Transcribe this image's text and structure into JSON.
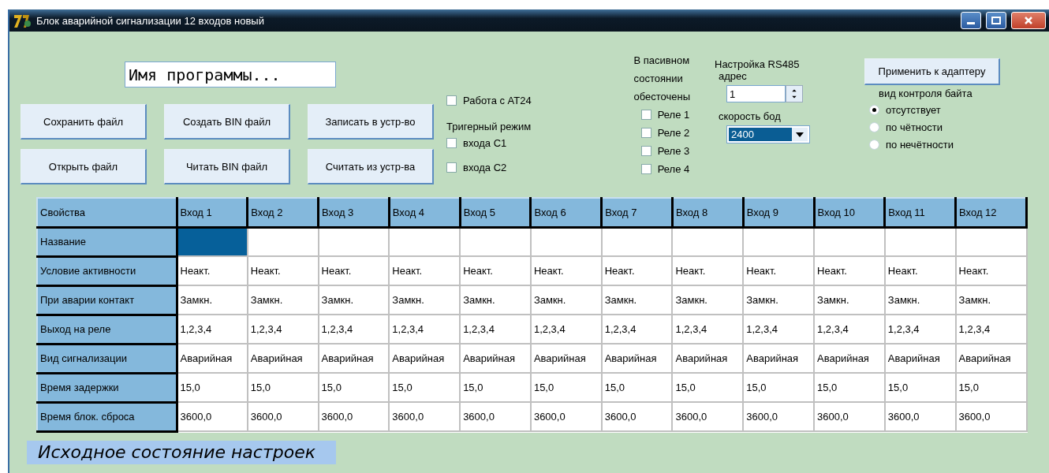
{
  "window": {
    "title": "Блок аварийной сигнализации 12 входов новый"
  },
  "program_name": {
    "value": "Имя программы..."
  },
  "file_buttons": [
    {
      "label": "Сохранить файл"
    },
    {
      "label": "Создать BIN файл"
    },
    {
      "label": "Записать в устр-во"
    },
    {
      "label": "Открыть файл"
    },
    {
      "label": "Читать BIN файл"
    },
    {
      "label": "Считать из устр-ва"
    }
  ],
  "at24": {
    "label": "Работа с AT24",
    "checked": false
  },
  "trigger_mode": {
    "title": "Тригерный режим",
    "items": [
      {
        "label": "входа C1",
        "checked": false
      },
      {
        "label": "входа C2",
        "checked": false
      }
    ]
  },
  "passive_relays": {
    "title": "В пасивном состоянии обесточены",
    "items": [
      {
        "label": "Реле 1",
        "checked": false
      },
      {
        "label": "Реле 2",
        "checked": false
      },
      {
        "label": "Реле 3",
        "checked": false
      },
      {
        "label": "Реле 4",
        "checked": false
      }
    ]
  },
  "rs485": {
    "title": "Настройка RS485",
    "address_label": "адрес",
    "address": "1",
    "baud_label": "скорость бод",
    "baud": "2400"
  },
  "apply_button": {
    "label": "Применить к адаптеру"
  },
  "byte_control": {
    "title": "вид контроля байта",
    "options": [
      {
        "label": "отсутствует",
        "selected": true
      },
      {
        "label": "по чётности",
        "selected": false
      },
      {
        "label": "по нечётности",
        "selected": false
      }
    ]
  },
  "table": {
    "columns": [
      "Свойства",
      "Вход 1",
      "Вход 2",
      "Вход 3",
      "Вход 4",
      "Вход 5",
      "Вход 6",
      "Вход 7",
      "Вход 8",
      "Вход 9",
      "Вход 10",
      "Вход 11",
      "Вход 12"
    ],
    "rows": [
      {
        "label": "Название",
        "cells": [
          {
            "selected": true
          },
          {
            "selected": false
          },
          {
            "selected": false
          },
          {
            "selected": false
          },
          {
            "selected": false
          },
          {
            "selected": false
          },
          {
            "selected": false
          },
          {
            "selected": false
          },
          {
            "selected": false
          },
          {
            "selected": false
          },
          {
            "selected": false
          },
          {
            "selected": false
          }
        ]
      },
      {
        "label": "Условие активности",
        "values": [
          "Неакт.",
          "Неакт.",
          "Неакт.",
          "Неакт.",
          "Неакт.",
          "Неакт.",
          "Неакт.",
          "Неакт.",
          "Неакт.",
          "Неакт.",
          "Неакт.",
          "Неакт."
        ]
      },
      {
        "label": "При аварии контакт",
        "values": [
          "Замкн.",
          "Замкн.",
          "Замкн.",
          "Замкн.",
          "Замкн.",
          "Замкн.",
          "Замкн.",
          "Замкн.",
          "Замкн.",
          "Замкн.",
          "Замкн.",
          "Замкн."
        ]
      },
      {
        "label": "Выход на реле",
        "values": [
          "1,2,3,4",
          "1,2,3,4",
          "1,2,3,4",
          "1,2,3,4",
          "1,2,3,4",
          "1,2,3,4",
          "1,2,3,4",
          "1,2,3,4",
          "1,2,3,4",
          "1,2,3,4",
          "1,2,3,4",
          "1,2,3,4"
        ]
      },
      {
        "label": "Вид сигнализации",
        "values": [
          "Аварийная",
          "Аварийная",
          "Аварийная",
          "Аварийная",
          "Аварийная",
          "Аварийная",
          "Аварийная",
          "Аварийная",
          "Аварийная",
          "Аварийная",
          "Аварийная",
          "Аварийная"
        ]
      },
      {
        "label": "Время задержки",
        "values": [
          "15,0",
          "15,0",
          "15,0",
          "15,0",
          "15,0",
          "15,0",
          "15,0",
          "15,0",
          "15,0",
          "15,0",
          "15,0",
          "15,0"
        ]
      },
      {
        "label": "Время блок. сброса",
        "values": [
          "3600,0",
          "3600,0",
          "3600,0",
          "3600,0",
          "3600,0",
          "3600,0",
          "3600,0",
          "3600,0",
          "3600,0",
          "3600,0",
          "3600,0",
          "3600,0"
        ]
      }
    ]
  },
  "status": "Исходное состояние настроек"
}
